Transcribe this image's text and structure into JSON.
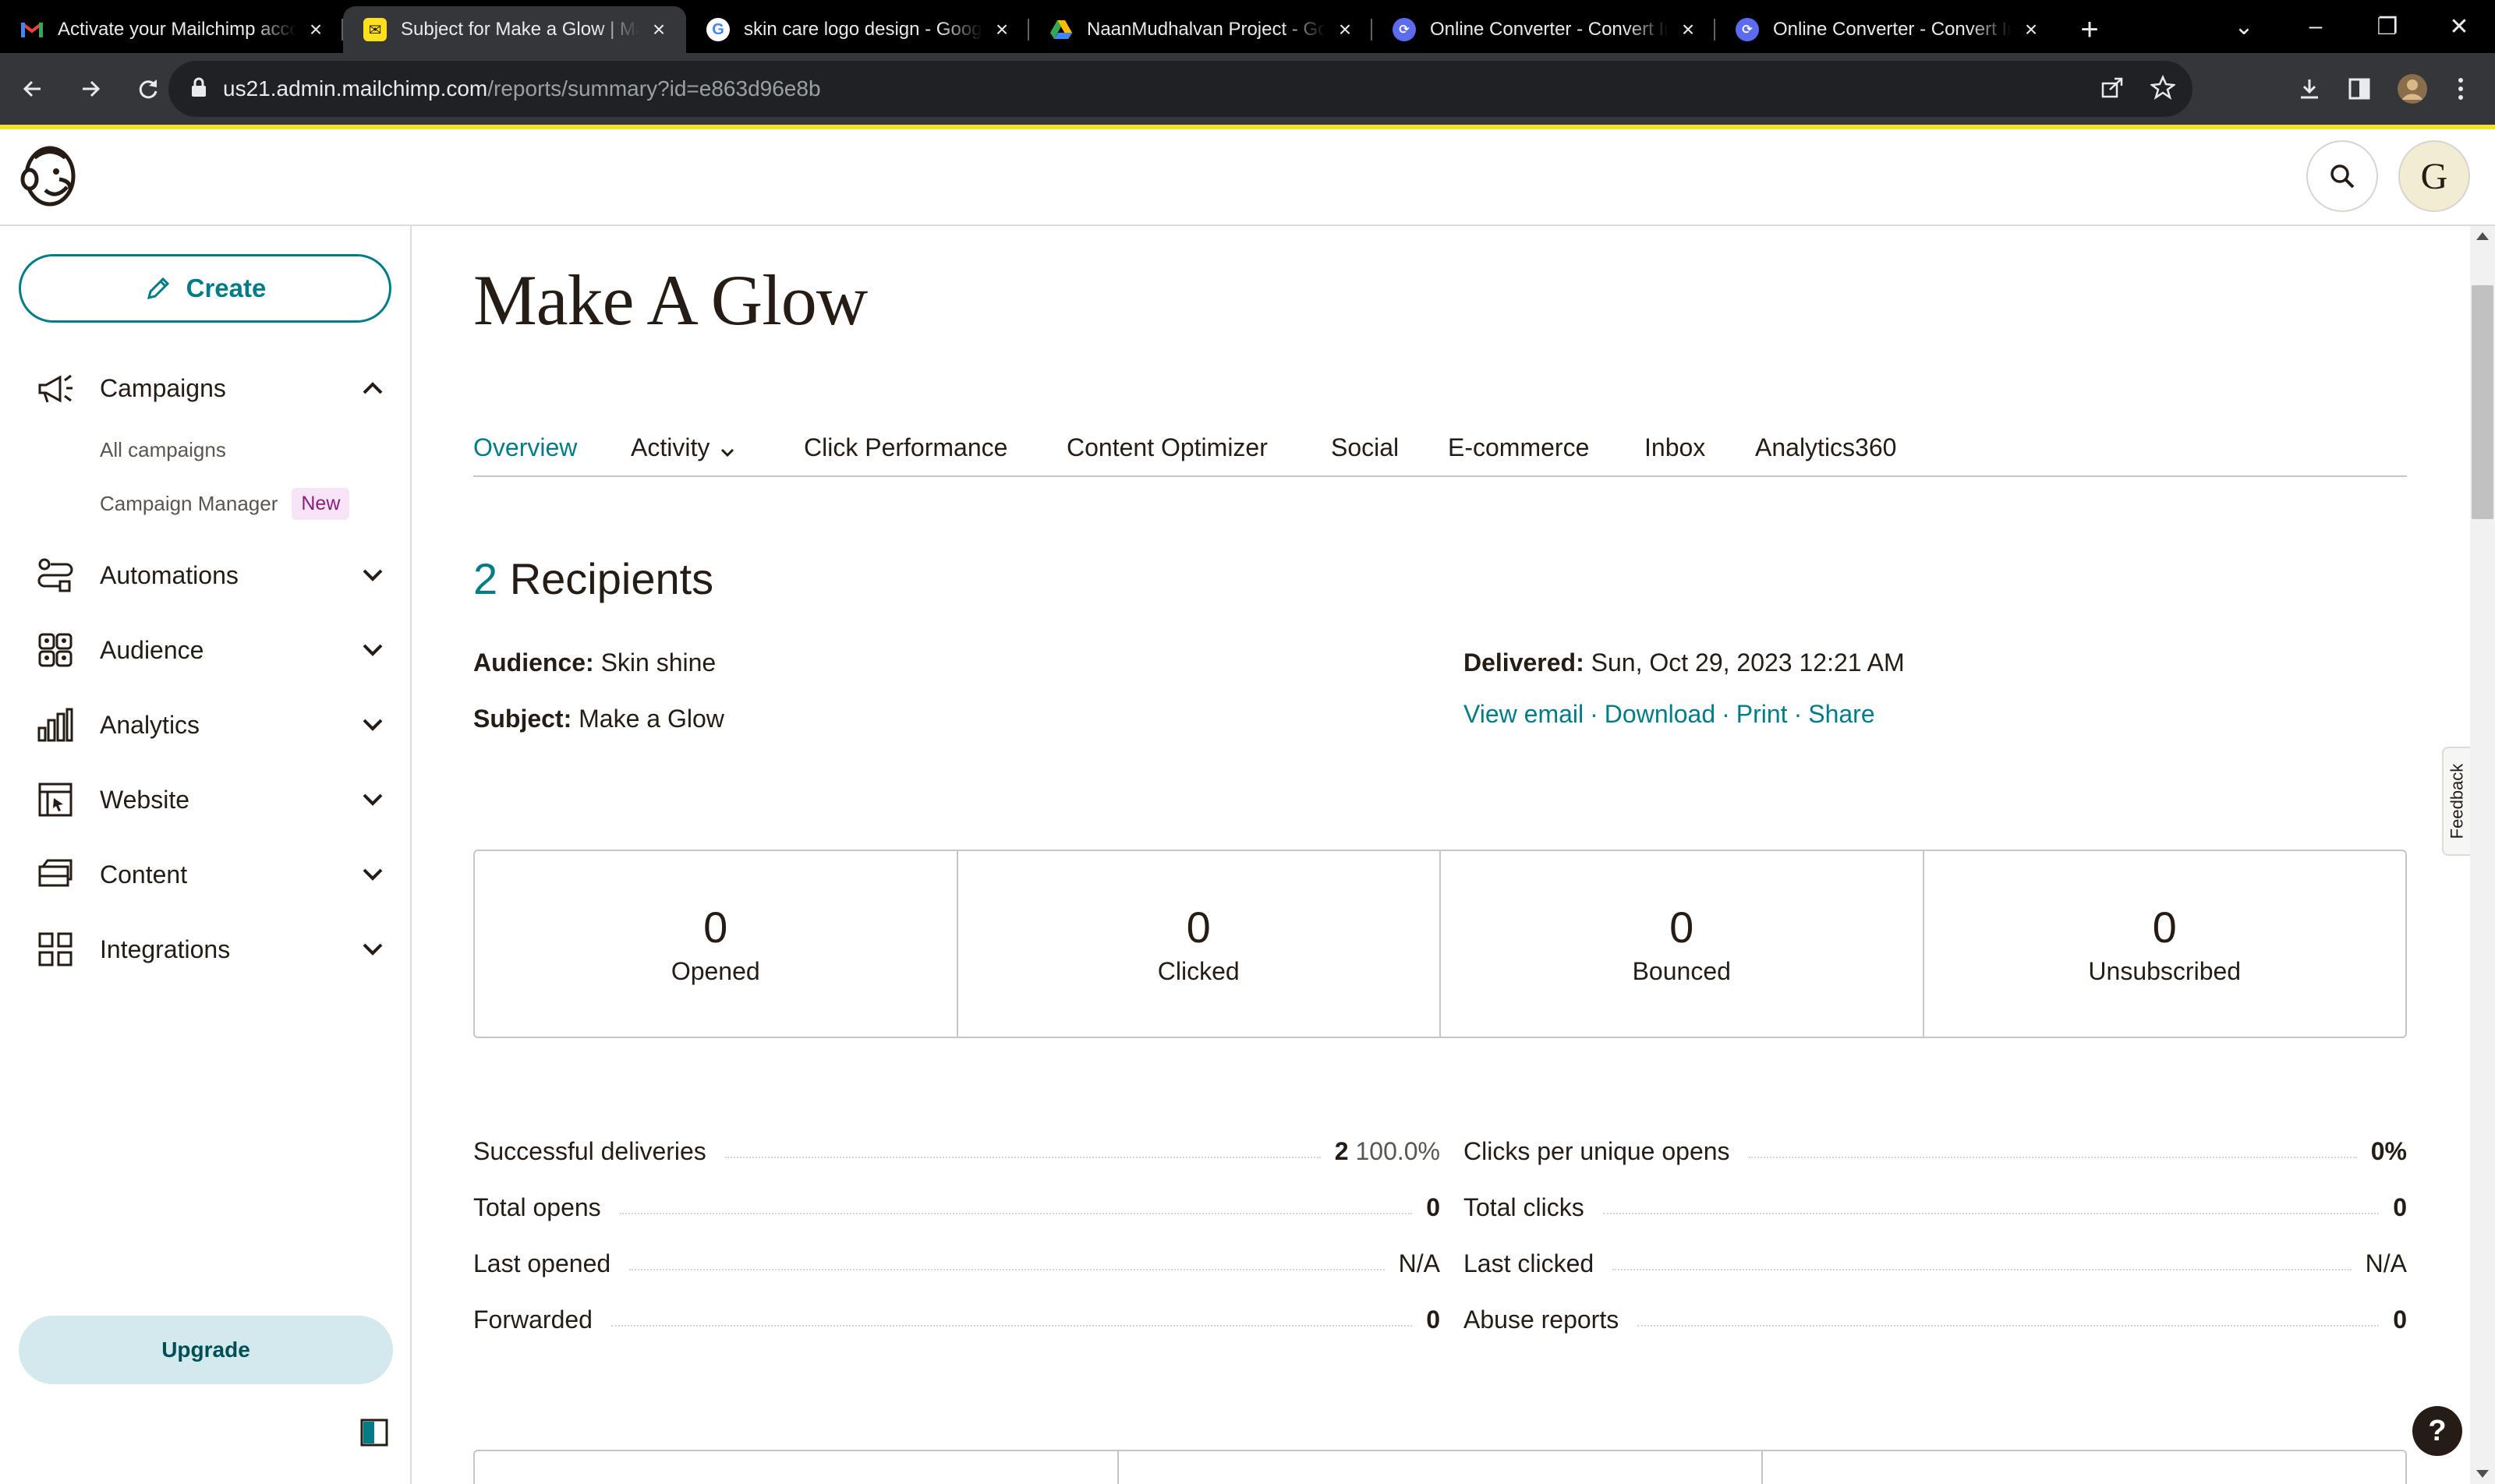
{
  "browser": {
    "tabs": [
      {
        "title": "Activate your Mailchimp account",
        "favicon": "gmail-icon",
        "active": false
      },
      {
        "title": "Subject for Make a Glow | Mailchimp",
        "favicon": "mailchimp-icon",
        "active": true
      },
      {
        "title": "skin care logo design - Google Search",
        "favicon": "google-icon",
        "active": false
      },
      {
        "title": "NaanMudhalvan Project - Google Drive",
        "favicon": "drive-icon",
        "active": false
      },
      {
        "title": "Online Converter - Convert Image",
        "favicon": "converter-icon",
        "active": false
      },
      {
        "title": "Online Converter - Convert Image",
        "favicon": "converter-icon",
        "active": false
      }
    ],
    "url_host": "us21.admin.mailchimp.com",
    "url_path": "/reports/summary?id=e863d96e8b"
  },
  "header": {
    "avatar_letter": "G"
  },
  "sidebar": {
    "create_label": "Create",
    "items": [
      {
        "label": "Campaigns",
        "icon": "megaphone-icon",
        "expanded": true
      },
      {
        "label": "Automations",
        "icon": "automation-icon",
        "expanded": false
      },
      {
        "label": "Audience",
        "icon": "audience-icon",
        "expanded": false
      },
      {
        "label": "Analytics",
        "icon": "bar-chart-icon",
        "expanded": false
      },
      {
        "label": "Website",
        "icon": "website-icon",
        "expanded": false
      },
      {
        "label": "Content",
        "icon": "content-icon",
        "expanded": false
      },
      {
        "label": "Integrations",
        "icon": "grid-icon",
        "expanded": false
      }
    ],
    "campaign_subitems": [
      "All campaigns",
      "Campaign Manager"
    ],
    "new_badge": "New",
    "upgrade_label": "Upgrade"
  },
  "page": {
    "title": "Make A Glow",
    "tabs": [
      "Overview",
      "Activity",
      "Click Performance",
      "Content Optimizer",
      "Social",
      "E-commerce",
      "Inbox",
      "Analytics360"
    ],
    "selected_tab": "Overview",
    "recipients_count": "2",
    "recipients_label": "Recipients",
    "audience_label": "Audience:",
    "audience_value": "Skin shine",
    "subject_label": "Subject:",
    "subject_value": "Make a Glow",
    "delivered_label": "Delivered:",
    "delivered_value": "Sun, Oct 29, 2023 12:21 AM",
    "links": [
      "View email",
      "Download",
      "Print",
      "Share"
    ],
    "stats": [
      {
        "value": "0",
        "label": "Opened"
      },
      {
        "value": "0",
        "label": "Clicked"
      },
      {
        "value": "0",
        "label": "Bounced"
      },
      {
        "value": "0",
        "label": "Unsubscribed"
      }
    ],
    "left_details": [
      {
        "label": "Successful deliveries",
        "value": "2",
        "extra": "100.0%"
      },
      {
        "label": "Total opens",
        "value": "0"
      },
      {
        "label": "Last opened",
        "value": "N/A"
      },
      {
        "label": "Forwarded",
        "value": "0"
      }
    ],
    "right_details": [
      {
        "label": "Clicks per unique opens",
        "value": "0%"
      },
      {
        "label": "Total clicks",
        "value": "0"
      },
      {
        "label": "Last clicked",
        "value": "N/A"
      },
      {
        "label": "Abuse reports",
        "value": "0"
      }
    ],
    "feedback_label": "Feedback",
    "help_label": "?"
  },
  "colors": {
    "accent": "#007c89",
    "brand_yellow": "#f2e12d",
    "text": "#241c15"
  }
}
